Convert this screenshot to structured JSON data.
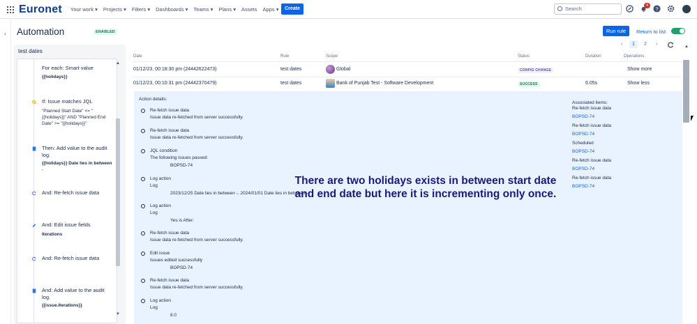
{
  "brand": {
    "logo": "Euronet",
    "accent": "#0c66e4"
  },
  "topnav": {
    "items": [
      "Your work ▾",
      "Projects ▾",
      "Filters ▾",
      "Dashboards ▾",
      "Teams ▾",
      "Plans ▾",
      "Assets",
      "Apps ▾"
    ],
    "create_label": "Create",
    "search_placeholder": "Search",
    "notification_count": "4",
    "icons": [
      "apps-grid-icon",
      "search-icon",
      "compass-icon",
      "bell-icon",
      "help-icon",
      "settings-icon",
      "avatar"
    ]
  },
  "page": {
    "title": "Automation",
    "status_badge": "ENABLED",
    "run_rule_label": "Run rule",
    "return_label": "Return to list"
  },
  "rule": {
    "name": "test dates",
    "components": [
      {
        "title": "For each: Smart value",
        "sub": "{{holidays}}",
        "icon": "loop-icon"
      },
      {
        "title": "If: Issue matches JQL",
        "sub": "\"Planned Start Date\" <= \"{{holidays}}\" AND \"Planned End Date\" >= \"{{holidays}}\"",
        "icon": "search-icon"
      },
      {
        "title": "Then: Add value to the audit log.",
        "sub_bold": "{{holidays}} Date lies in between",
        "sub_tail": " -",
        "icon": "document-icon"
      },
      {
        "title": "And: Re-fetch issue data",
        "sub": "",
        "icon": "refresh-icon"
      },
      {
        "title": "And: Edit issue fields",
        "sub": "Iterations",
        "icon": "pencil-icon"
      },
      {
        "title": "And: Re-fetch issue data",
        "sub": "",
        "icon": "refresh-icon"
      },
      {
        "title": "And: Add value to the audit log.",
        "sub": "{{issue.Iterations}}",
        "icon": "document-icon"
      }
    ]
  },
  "audit": {
    "headers": [
      "Date",
      "Rule",
      "Scope",
      "Status",
      "Duration",
      "Operations"
    ],
    "pager": {
      "prev": "‹",
      "current": "1",
      "next_page": "2",
      "next": "›"
    },
    "rows": [
      {
        "date": "01/12/23, 00:18:30 pm (24442622473)",
        "rule": "test dates",
        "scope": "Global",
        "status": "CONFIG CHANGE",
        "duration": "",
        "operation": "Show more"
      },
      {
        "date": "01/12/23, 00:10:31 pm (24442370479)",
        "rule": "test dates",
        "scope": "Bank of Punjab Test - Software Development",
        "status": "SUCCESS",
        "duration": "6.05s",
        "operation": "Show less"
      }
    ],
    "status_colors": {
      "config": "#5e4db2",
      "success": "#216e4e"
    }
  },
  "details": {
    "title": "Action details:",
    "items": [
      {
        "title": "Re-fetch issue data",
        "sub": "Issue data re-fetched from server successfully."
      },
      {
        "title": "Re-fetch issue data",
        "sub": "Issue data re-fetched from server successfully."
      },
      {
        "title": "JQL condition",
        "sub": "The following issues passed:",
        "val": "BOPSD-74"
      },
      {
        "title": "Log action",
        "sub": "Log",
        "val": "2023/12/25 Date lies in between -, 2024/01/01 Date lies in between -"
      },
      {
        "title": "Log action",
        "sub": "Log",
        "val": "Yes is After:"
      },
      {
        "title": "Re-fetch issue data",
        "sub": "Issue data re-fetched from server successfully."
      },
      {
        "title": "Edit issue",
        "sub": "Issues edited successfully",
        "val": "BOPSD-74"
      },
      {
        "title": "Re-fetch issue data",
        "sub": "Issue data re-fetched from server successfully."
      },
      {
        "title": "Log action",
        "sub": "Log",
        "val": "8.0"
      }
    ],
    "associated_title": "Associated items:",
    "associated": [
      {
        "label": "Re-fetch issue data",
        "link": "BOPSD-74"
      },
      {
        "label": "Re-fetch issue data",
        "link": "BOPSD-74"
      },
      {
        "label": "Scheduled",
        "link": "BOPSD-74"
      },
      {
        "label": "Re-fetch issue data",
        "link": "BOPSD-74"
      },
      {
        "label": "Re-fetch issue data",
        "link": "BOPSD-74"
      }
    ]
  },
  "annotation": "There are two holidays exists in between start date and end date but here it is incrementing only once."
}
